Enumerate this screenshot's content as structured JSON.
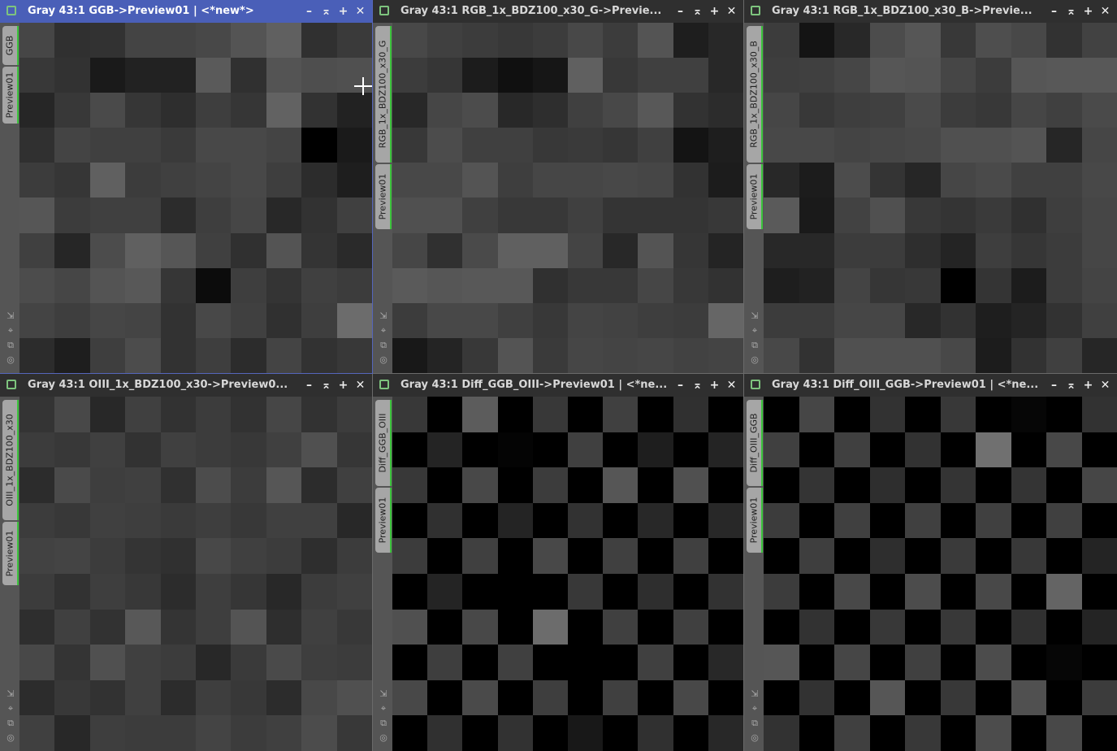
{
  "windows": [
    {
      "id": "ggb",
      "title": "Gray 43:1 GGB->Preview01 | <*new*>",
      "tabs": [
        {
          "label": "GGB",
          "height": 48
        },
        {
          "label": "Preview01",
          "height": 70
        }
      ],
      "active": true,
      "grid": [
        [
          70,
          48,
          50,
          68,
          68,
          72,
          84,
          96,
          48,
          58
        ],
        [
          56,
          50,
          26,
          34,
          34,
          90,
          48,
          84,
          78,
          80
        ],
        [
          38,
          56,
          74,
          54,
          46,
          62,
          54,
          98,
          50,
          34
        ],
        [
          48,
          68,
          64,
          64,
          58,
          72,
          72,
          68,
          0,
          26
        ],
        [
          60,
          54,
          96,
          60,
          64,
          68,
          72,
          62,
          44,
          30
        ],
        [
          86,
          60,
          64,
          64,
          44,
          62,
          70,
          40,
          50,
          64
        ],
        [
          64,
          38,
          76,
          96,
          86,
          64,
          48,
          84,
          52,
          42
        ],
        [
          76,
          70,
          84,
          88,
          54,
          12,
          62,
          52,
          64,
          60
        ],
        [
          68,
          62,
          70,
          68,
          50,
          72,
          64,
          48,
          62,
          108
        ],
        [
          44,
          30,
          62,
          76,
          50,
          62,
          44,
          68,
          50,
          56
        ]
      ]
    },
    {
      "id": "g",
      "title": "Gray 43:1 RGB_1x_BDZ100_x30_G->Previe...",
      "tabs": [
        {
          "label": "RGB_1x_BDZ100_x30_G",
          "height": 168
        },
        {
          "label": "Preview01",
          "height": 80
        }
      ],
      "active": false,
      "grid": [
        [
          72,
          64,
          60,
          56,
          60,
          72,
          60,
          84,
          30,
          40
        ],
        [
          60,
          54,
          28,
          16,
          22,
          96,
          56,
          64,
          64,
          40
        ],
        [
          40,
          70,
          76,
          40,
          46,
          64,
          72,
          88,
          50,
          44
        ],
        [
          56,
          76,
          64,
          64,
          56,
          58,
          54,
          64,
          20,
          30
        ],
        [
          72,
          72,
          84,
          62,
          70,
          70,
          72,
          70,
          50,
          28
        ],
        [
          80,
          80,
          64,
          56,
          56,
          64,
          52,
          52,
          52,
          56
        ],
        [
          70,
          48,
          74,
          96,
          96,
          68,
          40,
          84,
          54,
          36
        ],
        [
          90,
          86,
          88,
          88,
          48,
          56,
          56,
          70,
          56,
          50
        ],
        [
          60,
          72,
          72,
          64,
          56,
          68,
          66,
          62,
          60,
          102
        ],
        [
          24,
          36,
          56,
          84,
          58,
          70,
          68,
          70,
          66,
          68
        ]
      ]
    },
    {
      "id": "b",
      "title": "Gray 43:1 RGB_1x_BDZ100_x30_B->Previe...",
      "tabs": [
        {
          "label": "RGB_1x_BDZ100_x30_B",
          "height": 168
        },
        {
          "label": "Preview01",
          "height": 80
        }
      ],
      "active": false,
      "grid": [
        [
          60,
          20,
          40,
          76,
          86,
          56,
          78,
          72,
          50,
          66
        ],
        [
          62,
          64,
          70,
          86,
          84,
          70,
          60,
          86,
          88,
          88
        ],
        [
          70,
          56,
          62,
          64,
          74,
          60,
          56,
          70,
          64,
          74
        ],
        [
          72,
          72,
          68,
          70,
          72,
          80,
          80,
          84,
          38,
          70
        ],
        [
          40,
          28,
          76,
          52,
          38,
          70,
          74,
          64,
          64,
          72
        ],
        [
          90,
          26,
          66,
          80,
          56,
          52,
          58,
          48,
          62,
          70
        ],
        [
          40,
          40,
          60,
          60,
          46,
          36,
          62,
          54,
          60,
          70
        ],
        [
          30,
          34,
          68,
          54,
          56,
          0,
          52,
          28,
          60,
          68
        ],
        [
          60,
          60,
          70,
          70,
          40,
          50,
          30,
          36,
          50,
          64
        ],
        [
          72,
          50,
          80,
          80,
          80,
          72,
          28,
          50,
          64,
          38
        ]
      ]
    },
    {
      "id": "oiii",
      "title": "Gray 43:1 OIII_1x_BDZ100_x30->Preview0...",
      "tabs": [
        {
          "label": "OIII_1x_BDZ100_x30",
          "height": 148
        },
        {
          "label": "Preview01",
          "height": 78
        }
      ],
      "active": false,
      "grid": [
        [
          52,
          72,
          40,
          64,
          50,
          60,
          50,
          70,
          50,
          60
        ],
        [
          60,
          56,
          64,
          50,
          64,
          60,
          56,
          64,
          80,
          54
        ],
        [
          44,
          74,
          62,
          64,
          48,
          76,
          60,
          86,
          44,
          64
        ],
        [
          60,
          56,
          64,
          62,
          58,
          62,
          56,
          64,
          64,
          40
        ],
        [
          66,
          68,
          60,
          52,
          48,
          72,
          64,
          60,
          46,
          60
        ],
        [
          60,
          50,
          62,
          56,
          44,
          62,
          54,
          40,
          60,
          64
        ],
        [
          46,
          64,
          50,
          88,
          52,
          62,
          84,
          46,
          64,
          56
        ],
        [
          72,
          52,
          80,
          64,
          60,
          40,
          58,
          74,
          62,
          60
        ],
        [
          44,
          56,
          50,
          64,
          44,
          62,
          56,
          44,
          72,
          80
        ],
        [
          64,
          40,
          62,
          60,
          60,
          68,
          60,
          64,
          76,
          56
        ]
      ]
    },
    {
      "id": "diff1",
      "title": "Gray 43:1 Diff_GGB_OIII->Preview01 | <*ne...",
      "tabs": [
        {
          "label": "Diff_GGB_OIII",
          "height": 106
        },
        {
          "label": "Preview01",
          "height": 80
        }
      ],
      "active": false,
      "grid": [
        [
          56,
          0,
          92,
          0,
          56,
          0,
          64,
          0,
          48,
          0
        ],
        [
          0,
          36,
          0,
          4,
          0,
          64,
          0,
          30,
          0,
          36
        ],
        [
          56,
          0,
          72,
          0,
          60,
          0,
          86,
          0,
          80,
          0
        ],
        [
          0,
          48,
          0,
          36,
          0,
          50,
          0,
          40,
          0,
          40
        ],
        [
          60,
          0,
          64,
          0,
          72,
          0,
          64,
          0,
          64,
          0
        ],
        [
          0,
          36,
          0,
          0,
          0,
          56,
          0,
          46,
          0,
          50
        ],
        [
          80,
          0,
          72,
          0,
          108,
          0,
          64,
          0,
          64,
          0
        ],
        [
          0,
          62,
          0,
          64,
          0,
          0,
          0,
          64,
          0,
          40
        ],
        [
          72,
          0,
          74,
          0,
          62,
          0,
          64,
          0,
          72,
          0
        ],
        [
          0,
          48,
          0,
          50,
          0,
          24,
          0,
          48,
          0,
          40
        ]
      ]
    },
    {
      "id": "diff2",
      "title": "Gray 43:1 Diff_OIII_GGB->Preview01 | <*ne...",
      "tabs": [
        {
          "label": "Diff_OIII_GGB",
          "height": 106
        },
        {
          "label": "Preview01",
          "height": 80
        }
      ],
      "active": false,
      "grid": [
        [
          0,
          70,
          0,
          50,
          0,
          56,
          0,
          6,
          0,
          50
        ],
        [
          64,
          0,
          64,
          0,
          50,
          0,
          112,
          0,
          72,
          0
        ],
        [
          0,
          52,
          0,
          46,
          0,
          52,
          0,
          52,
          0,
          70
        ],
        [
          60,
          0,
          64,
          0,
          64,
          0,
          64,
          0,
          64,
          0
        ],
        [
          0,
          62,
          0,
          46,
          0,
          58,
          0,
          56,
          0,
          36
        ],
        [
          60,
          0,
          72,
          0,
          76,
          0,
          72,
          0,
          100,
          0
        ],
        [
          0,
          50,
          0,
          56,
          0,
          56,
          0,
          48,
          0,
          36
        ],
        [
          86,
          0,
          70,
          0,
          64,
          0,
          76,
          0,
          6,
          0
        ],
        [
          0,
          50,
          0,
          86,
          0,
          56,
          0,
          80,
          0,
          60
        ],
        [
          50,
          0,
          64,
          0,
          56,
          0,
          76,
          0,
          72,
          0
        ]
      ]
    }
  ]
}
